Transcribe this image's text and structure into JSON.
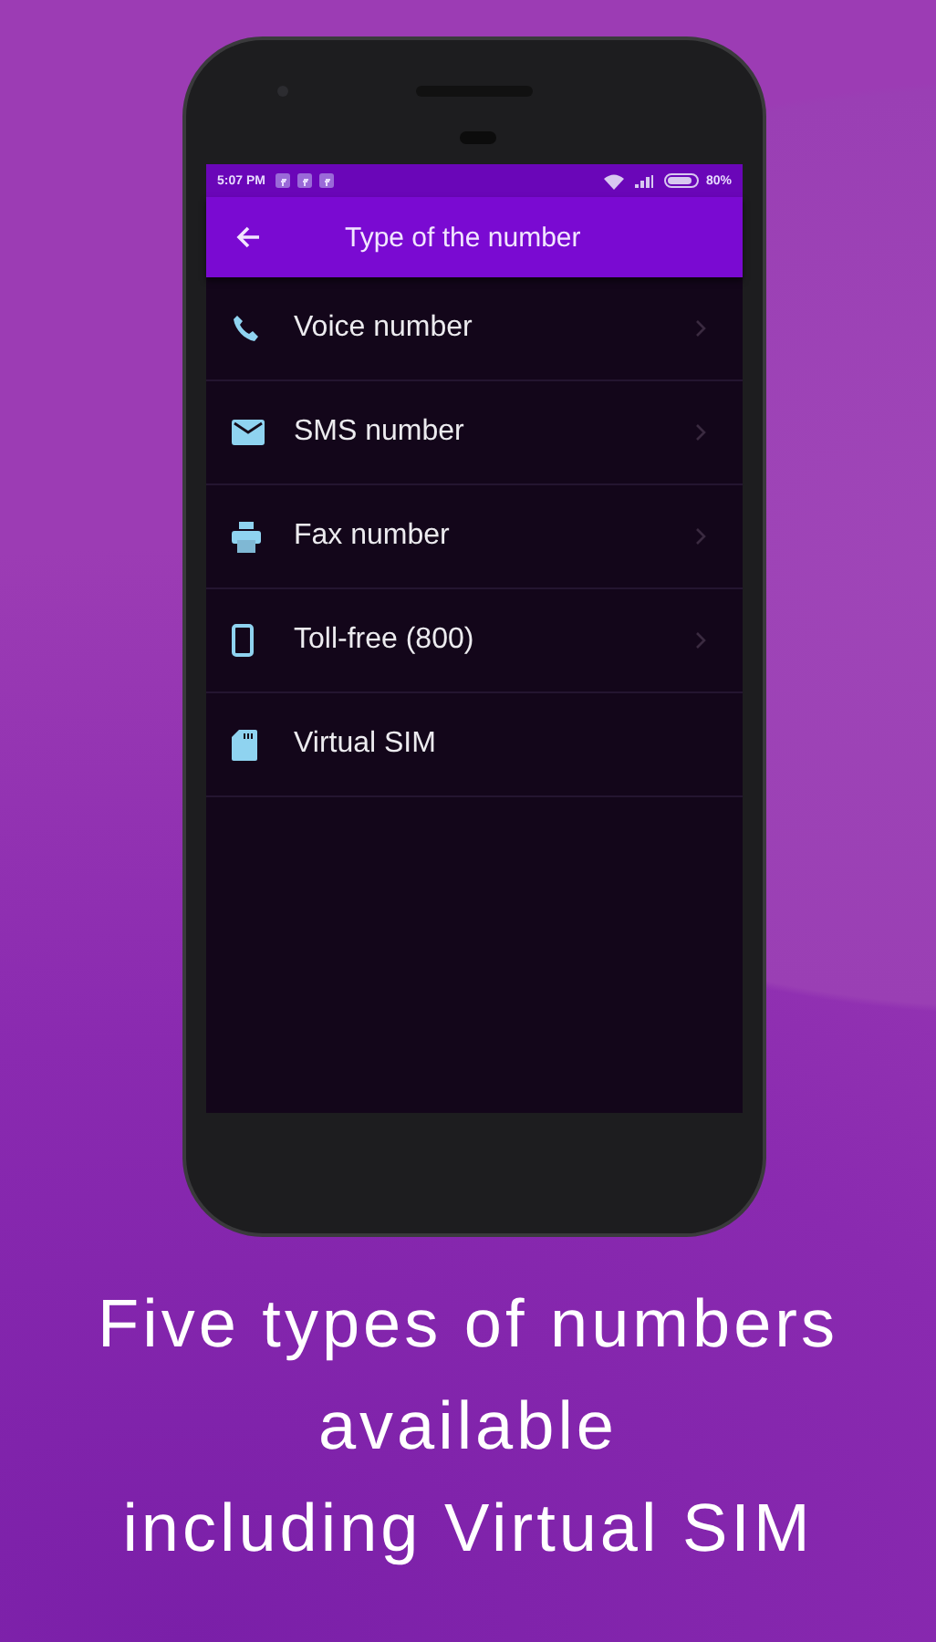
{
  "status_bar": {
    "time": "5:07 PM",
    "battery": "80%"
  },
  "app_bar": {
    "title": "Type of the number"
  },
  "items": [
    {
      "kind": "voice",
      "label": "Voice number",
      "chevron": true
    },
    {
      "kind": "sms",
      "label": "SMS number",
      "chevron": true
    },
    {
      "kind": "fax",
      "label": "Fax number",
      "chevron": true
    },
    {
      "kind": "tollfree",
      "label": "Toll-free (800)",
      "chevron": true
    },
    {
      "kind": "sim",
      "label": "Virtual SIM",
      "chevron": false
    }
  ],
  "caption": "Five types of numbers\navailable\n including Virtual SIM"
}
